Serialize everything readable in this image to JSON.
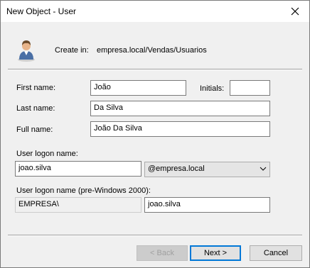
{
  "window": {
    "title": "New Object - User"
  },
  "header": {
    "create_in_label": "Create in:",
    "create_in_path": "empresa.local/Vendas/Usuarios",
    "icon": "user-icon"
  },
  "form": {
    "first_name": {
      "label": "First name:",
      "value": "João"
    },
    "initials": {
      "label": "Initials:",
      "value": ""
    },
    "last_name": {
      "label": "Last name:",
      "value": "Da Silva"
    },
    "full_name": {
      "label": "Full name:",
      "value": "João Da Silva"
    },
    "logon_name": {
      "label": "User logon name:",
      "value": "joao.silva",
      "domain": "@empresa.local"
    },
    "pre2000": {
      "label": "User logon name (pre-Windows 2000):",
      "domain": "EMPRESA\\",
      "value": "joao.silva"
    }
  },
  "buttons": {
    "back": "< Back",
    "next": "Next >",
    "cancel": "Cancel"
  }
}
